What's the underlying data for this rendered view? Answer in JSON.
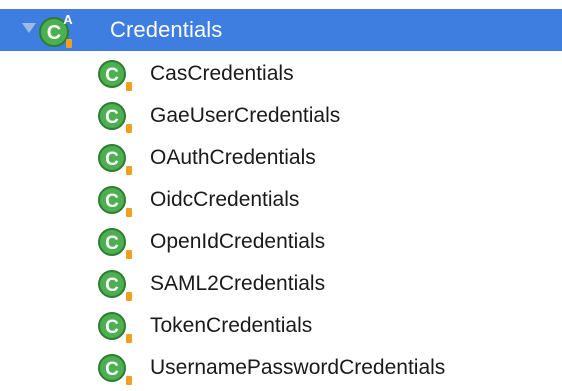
{
  "tree": {
    "root": {
      "label": "Credentials",
      "expanded": true,
      "icon": "abstract-class-icon",
      "icon_letter": "C",
      "abstract_marker": "A"
    },
    "children": [
      {
        "label": "CasCredentials",
        "icon": "class-icon",
        "icon_letter": "C"
      },
      {
        "label": "GaeUserCredentials",
        "icon": "class-icon",
        "icon_letter": "C"
      },
      {
        "label": "OAuthCredentials",
        "icon": "class-icon",
        "icon_letter": "C"
      },
      {
        "label": "OidcCredentials",
        "icon": "class-icon",
        "icon_letter": "C"
      },
      {
        "label": "OpenIdCredentials",
        "icon": "class-icon",
        "icon_letter": "C"
      },
      {
        "label": "SAML2Credentials",
        "icon": "class-icon",
        "icon_letter": "C"
      },
      {
        "label": "TokenCredentials",
        "icon": "class-icon",
        "icon_letter": "C"
      },
      {
        "label": "UsernamePasswordCredentials",
        "icon": "class-icon",
        "icon_letter": "C"
      }
    ]
  },
  "colors": {
    "selection": "#3d7ee0",
    "class_icon_green": "#4caf50",
    "access_marker_orange": "#f0a020"
  }
}
